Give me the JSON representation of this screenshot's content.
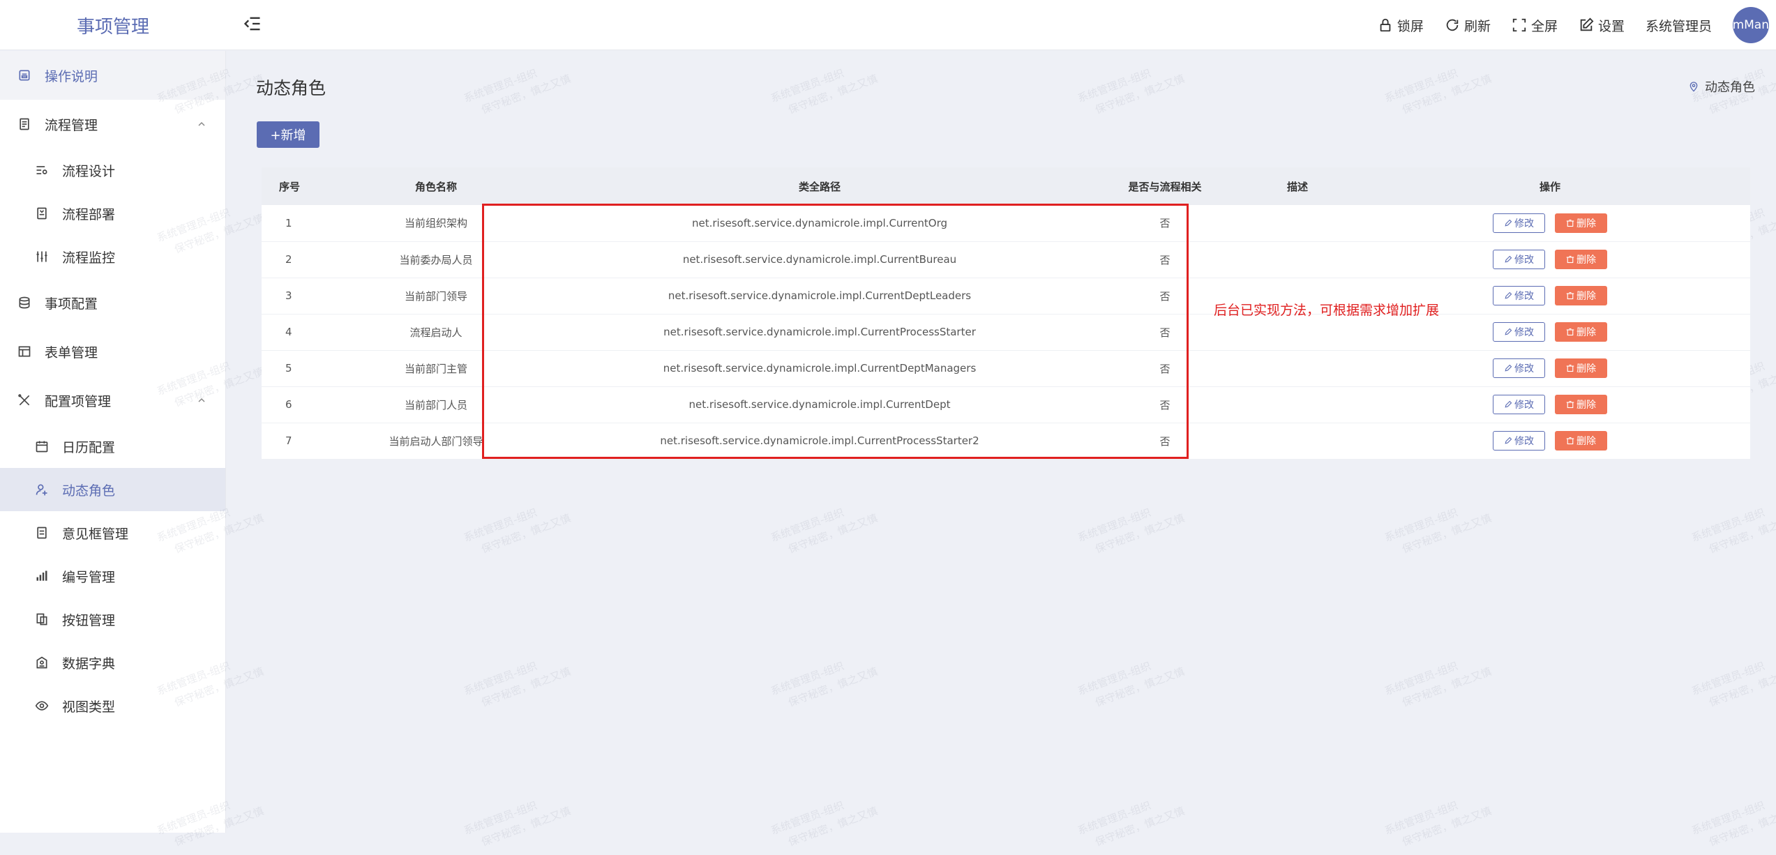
{
  "app": {
    "title": "事项管理"
  },
  "header": {
    "actions": [
      {
        "icon": "lock-icon",
        "label": "锁屏"
      },
      {
        "icon": "refresh-icon",
        "label": "刷新"
      },
      {
        "icon": "fullscreen-icon",
        "label": "全屏"
      },
      {
        "icon": "edit-icon",
        "label": "设置"
      }
    ],
    "user": "系统管理员",
    "avatar_text": "SystemMan"
  },
  "sidebar": {
    "items": [
      {
        "label": "操作说明",
        "icon": "document-icon"
      },
      {
        "label": "流程管理",
        "icon": "clipboard-icon",
        "expanded": true
      },
      {
        "label": "流程设计",
        "icon": "flow-design-icon"
      },
      {
        "label": "流程部署",
        "icon": "deploy-icon"
      },
      {
        "label": "流程监控",
        "icon": "monitor-icon"
      },
      {
        "label": "事项配置",
        "icon": "database-icon"
      },
      {
        "label": "表单管理",
        "icon": "table-icon"
      },
      {
        "label": "配置项管理",
        "icon": "tools-icon",
        "expanded": true
      },
      {
        "label": "日历配置",
        "icon": "calendar-icon"
      },
      {
        "label": "动态角色",
        "icon": "user-add-icon",
        "active": true
      },
      {
        "label": "意见框管理",
        "icon": "list-icon"
      },
      {
        "label": "编号管理",
        "icon": "bar-chart-icon"
      },
      {
        "label": "按钮管理",
        "icon": "copy-icon"
      },
      {
        "label": "数据字典",
        "icon": "book-icon"
      },
      {
        "label": "视图类型",
        "icon": "eye-icon"
      }
    ]
  },
  "page": {
    "title": "动态角色",
    "breadcrumb": "动态角色",
    "add_button": "+新增",
    "columns": [
      "序号",
      "角色名称",
      "类全路径",
      "是否与流程相关",
      "描述",
      "操作"
    ],
    "rows": [
      {
        "no": "1",
        "name": "当前组织架构",
        "path": "net.risesoft.service.dynamicrole.impl.CurrentOrg",
        "related": "否",
        "desc": ""
      },
      {
        "no": "2",
        "name": "当前委办局人员",
        "path": "net.risesoft.service.dynamicrole.impl.CurrentBureau",
        "related": "否",
        "desc": ""
      },
      {
        "no": "3",
        "name": "当前部门领导",
        "path": "net.risesoft.service.dynamicrole.impl.CurrentDeptLeaders",
        "related": "否",
        "desc": ""
      },
      {
        "no": "4",
        "name": "流程启动人",
        "path": "net.risesoft.service.dynamicrole.impl.CurrentProcessStarter",
        "related": "否",
        "desc": ""
      },
      {
        "no": "5",
        "name": "当前部门主管",
        "path": "net.risesoft.service.dynamicrole.impl.CurrentDeptManagers",
        "related": "否",
        "desc": ""
      },
      {
        "no": "6",
        "name": "当前部门人员",
        "path": "net.risesoft.service.dynamicrole.impl.CurrentDept",
        "related": "否",
        "desc": ""
      },
      {
        "no": "7",
        "name": "当前启动人部门领导",
        "path": "net.risesoft.service.dynamicrole.impl.CurrentProcessStarter2",
        "related": "否",
        "desc": ""
      }
    ],
    "edit_label": "修改",
    "delete_label": "删除",
    "annotation": "后台已实现方法，可根据需求增加扩展"
  },
  "watermark": {
    "line1": "系统管理员-组织",
    "line2": "保守秘密，慎之又慎"
  },
  "colors": {
    "accent": "#5b6cb3",
    "danger": "#f07456",
    "annotation": "#e02020"
  }
}
